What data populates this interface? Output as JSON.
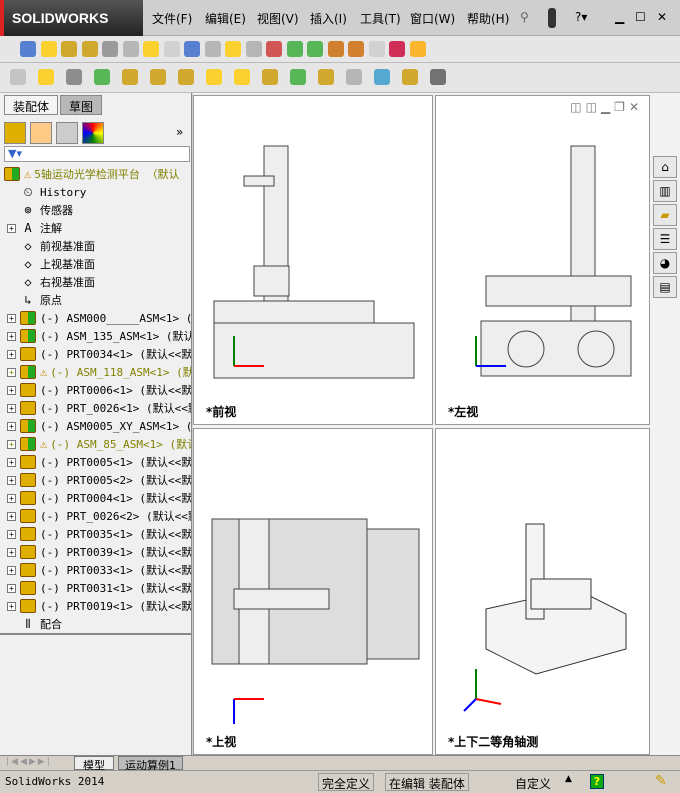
{
  "app": {
    "logo": "SOLIDWORKS",
    "version": "SolidWorks 2014"
  },
  "menu": [
    "文件(F)",
    "编辑(E)",
    "视图(V)",
    "插入(I)",
    "工具(T)",
    "窗口(W)",
    "帮助(H)"
  ],
  "panel": {
    "tabs": [
      "装配体",
      "草图"
    ],
    "filter_icon": "filter-icon"
  },
  "tree": {
    "root": "5轴运动光学检测平台 （默认",
    "items": [
      {
        "label": "History",
        "icon": "history"
      },
      {
        "label": "传感器",
        "icon": "sensor"
      },
      {
        "label": "注解",
        "icon": "annotation",
        "expand": true
      },
      {
        "label": "前视基准面",
        "icon": "plane"
      },
      {
        "label": "上视基准面",
        "icon": "plane"
      },
      {
        "label": "右视基准面",
        "icon": "plane"
      },
      {
        "label": "原点",
        "icon": "origin"
      },
      {
        "label": "(-) ASM000_____ASM<1> (默认",
        "icon": "asm",
        "expand": true
      },
      {
        "label": "(-) ASM_135_ASM<1> (默认<",
        "icon": "asm",
        "expand": true
      },
      {
        "label": "(-) PRT0034<1> (默认<<默认",
        "icon": "part",
        "expand": true
      },
      {
        "label": "(-) ASM_118_ASM<1> (默",
        "icon": "asm",
        "expand": true,
        "warn": true
      },
      {
        "label": "(-) PRT0006<1> (默认<<默认",
        "icon": "part",
        "expand": true
      },
      {
        "label": "(-) PRT_0026<1> (默认<<默",
        "icon": "part",
        "expand": true
      },
      {
        "label": "(-) ASM0005_XY_ASM<1> (默",
        "icon": "asm",
        "expand": true
      },
      {
        "label": "(-) ASM_85_ASM<1> (默认",
        "icon": "asm",
        "expand": true,
        "warn": true
      },
      {
        "label": "(-) PRT0005<1> (默认<<默认",
        "icon": "part",
        "expand": true
      },
      {
        "label": "(-) PRT0005<2> (默认<<默认",
        "icon": "part",
        "expand": true
      },
      {
        "label": "(-) PRT0004<1> (默认<<默认",
        "icon": "part",
        "expand": true
      },
      {
        "label": "(-) PRT_0026<2> (默认<<默",
        "icon": "part",
        "expand": true
      },
      {
        "label": "(-) PRT0035<1> (默认<<默认",
        "icon": "part",
        "expand": true
      },
      {
        "label": "(-) PRT0039<1> (默认<<默认",
        "icon": "part",
        "expand": true
      },
      {
        "label": "(-) PRT0033<1> (默认<<默认",
        "icon": "part",
        "expand": true
      },
      {
        "label": "(-) PRT0031<1> (默认<<默认",
        "icon": "part",
        "expand": true
      },
      {
        "label": "(-) PRT0019<1> (默认<<默认",
        "icon": "part",
        "expand": true
      },
      {
        "label": "配合",
        "icon": "mates"
      }
    ]
  },
  "viewports": [
    {
      "label": "*前视"
    },
    {
      "label": "*左视"
    },
    {
      "label": "*上视"
    },
    {
      "label": "*上下二等角轴测"
    }
  ],
  "bottom_tabs": [
    "模型",
    "运动算例1"
  ],
  "status": {
    "left": "SolidWorks 2014",
    "state": "完全定义",
    "editing": "在编辑 装配体",
    "units": "自定义",
    "help": "?"
  },
  "colors": {
    "accent": "#d22",
    "warning": "#808000"
  }
}
